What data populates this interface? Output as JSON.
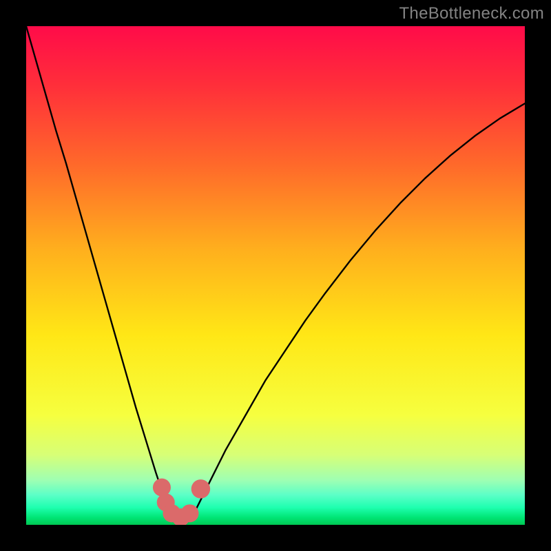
{
  "watermark": "TheBottleneck.com",
  "chart_data": {
    "type": "line",
    "title": "",
    "xlabel": "",
    "ylabel": "",
    "xlim": [
      0,
      100
    ],
    "ylim": [
      0,
      100
    ],
    "grid": false,
    "legend": false,
    "gradient_stops": [
      {
        "pos": 0.0,
        "color": "#ff0b49"
      },
      {
        "pos": 0.12,
        "color": "#ff2f3a"
      },
      {
        "pos": 0.28,
        "color": "#ff6a2a"
      },
      {
        "pos": 0.45,
        "color": "#ffb01d"
      },
      {
        "pos": 0.62,
        "color": "#ffe716"
      },
      {
        "pos": 0.78,
        "color": "#f6ff3f"
      },
      {
        "pos": 0.86,
        "color": "#d7ff77"
      },
      {
        "pos": 0.91,
        "color": "#9fffb2"
      },
      {
        "pos": 0.94,
        "color": "#5cffc7"
      },
      {
        "pos": 0.965,
        "color": "#1fffb0"
      },
      {
        "pos": 0.985,
        "color": "#00e676"
      },
      {
        "pos": 1.0,
        "color": "#00c853"
      }
    ],
    "series": [
      {
        "name": "bottleneck-curve",
        "x": [
          0.0,
          2.0,
          4.0,
          6.0,
          8.0,
          10.0,
          12.0,
          14.0,
          16.0,
          18.0,
          20.0,
          22.0,
          24.0,
          26.0,
          27.5,
          29.0,
          30.0,
          31.0,
          32.0,
          33.0,
          34.0,
          35.0,
          37.0,
          40.0,
          44.0,
          48.0,
          52.0,
          56.0,
          60.0,
          65.0,
          70.0,
          75.0,
          80.0,
          85.0,
          90.0,
          95.0,
          100.0
        ],
        "y": [
          100.0,
          93.0,
          86.0,
          79.0,
          72.5,
          65.5,
          58.5,
          51.5,
          44.5,
          37.5,
          30.5,
          23.5,
          17.0,
          10.5,
          6.0,
          3.0,
          1.5,
          1.0,
          1.0,
          1.5,
          3.0,
          5.0,
          9.0,
          15.0,
          22.0,
          29.0,
          35.0,
          41.0,
          46.5,
          53.0,
          59.0,
          64.5,
          69.5,
          74.0,
          78.0,
          81.5,
          84.5
        ]
      }
    ],
    "markers": [
      {
        "name": "marker-left-top",
        "x": 27.2,
        "y": 7.5,
        "r": 1.8,
        "color": "#db6a6a"
      },
      {
        "name": "marker-left-mid",
        "x": 28.0,
        "y": 4.5,
        "r": 1.8,
        "color": "#db6a6a"
      },
      {
        "name": "marker-bottom-a",
        "x": 29.2,
        "y": 2.3,
        "r": 1.8,
        "color": "#db6a6a"
      },
      {
        "name": "marker-bottom-b",
        "x": 31.0,
        "y": 1.5,
        "r": 1.8,
        "color": "#db6a6a"
      },
      {
        "name": "marker-bottom-c",
        "x": 32.8,
        "y": 2.3,
        "r": 1.8,
        "color": "#db6a6a"
      },
      {
        "name": "marker-right",
        "x": 35.0,
        "y": 7.2,
        "r": 1.9,
        "color": "#db6a6a"
      }
    ]
  }
}
